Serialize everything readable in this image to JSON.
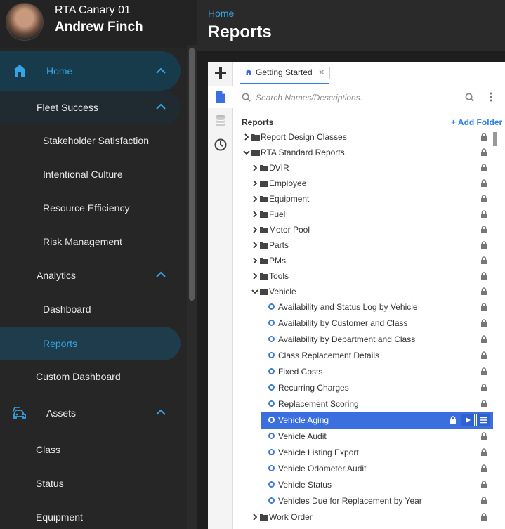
{
  "profile": {
    "org": "RTA Canary 01",
    "user": "Andrew Finch"
  },
  "nav": {
    "home": "Home",
    "fleet_success": "Fleet Success",
    "stakeholder": "Stakeholder Satisfaction",
    "culture": "Intentional Culture",
    "resource": "Resource Efficiency",
    "risk": "Risk Management",
    "analytics": "Analytics",
    "dashboard": "Dashboard",
    "reports": "Reports",
    "custom_dashboard": "Custom Dashboard",
    "assets": "Assets",
    "class": "Class",
    "status": "Status",
    "equipment": "Equipment"
  },
  "header": {
    "breadcrumb": "Home",
    "title": "Reports"
  },
  "tabs": {
    "getting_started": "Getting Started"
  },
  "search": {
    "placeholder": "Search Names/Descriptions."
  },
  "tree": {
    "title": "Reports",
    "add_folder": "+ Add Folder",
    "items": [
      {
        "label": "Report Design Classes",
        "kind": "folder",
        "level": 0,
        "expanded": false
      },
      {
        "label": "RTA Standard Reports",
        "kind": "folder",
        "level": 0,
        "expanded": true
      },
      {
        "label": "DVIR",
        "kind": "folder",
        "level": 1,
        "expanded": false
      },
      {
        "label": "Employee",
        "kind": "folder",
        "level": 1,
        "expanded": false
      },
      {
        "label": "Equipment",
        "kind": "folder",
        "level": 1,
        "expanded": false
      },
      {
        "label": "Fuel",
        "kind": "folder",
        "level": 1,
        "expanded": false
      },
      {
        "label": "Motor Pool",
        "kind": "folder",
        "level": 1,
        "expanded": false
      },
      {
        "label": "Parts",
        "kind": "folder",
        "level": 1,
        "expanded": false
      },
      {
        "label": "PMs",
        "kind": "folder",
        "level": 1,
        "expanded": false
      },
      {
        "label": "Tools",
        "kind": "folder",
        "level": 1,
        "expanded": false
      },
      {
        "label": "Vehicle",
        "kind": "folder",
        "level": 1,
        "expanded": true
      },
      {
        "label": "Availability and Status Log by Vehicle",
        "kind": "report",
        "level": 2
      },
      {
        "label": "Availability by Customer and Class",
        "kind": "report",
        "level": 2
      },
      {
        "label": "Availability by Department and Class",
        "kind": "report",
        "level": 2
      },
      {
        "label": "Class Replacement Details",
        "kind": "report",
        "level": 2
      },
      {
        "label": "Fixed Costs",
        "kind": "report",
        "level": 2
      },
      {
        "label": "Recurring Charges",
        "kind": "report",
        "level": 2
      },
      {
        "label": "Replacement Scoring",
        "kind": "report",
        "level": 2
      },
      {
        "label": "Vehicle Aging",
        "kind": "report",
        "level": 2,
        "selected": true
      },
      {
        "label": "Vehicle Audit",
        "kind": "report",
        "level": 2
      },
      {
        "label": "Vehicle Listing Export",
        "kind": "report",
        "level": 2
      },
      {
        "label": "Vehicle Odometer Audit",
        "kind": "report",
        "level": 2
      },
      {
        "label": "Vehicle Status",
        "kind": "report",
        "level": 2
      },
      {
        "label": "Vehicles Due for Replacement by Year",
        "kind": "report",
        "level": 2
      },
      {
        "label": "Work Order",
        "kind": "folder",
        "level": 1,
        "expanded": false
      }
    ]
  },
  "colors": {
    "accent": "#35a3e6",
    "selection": "#3b6fe0",
    "report_dot": "#3a7bd5"
  }
}
